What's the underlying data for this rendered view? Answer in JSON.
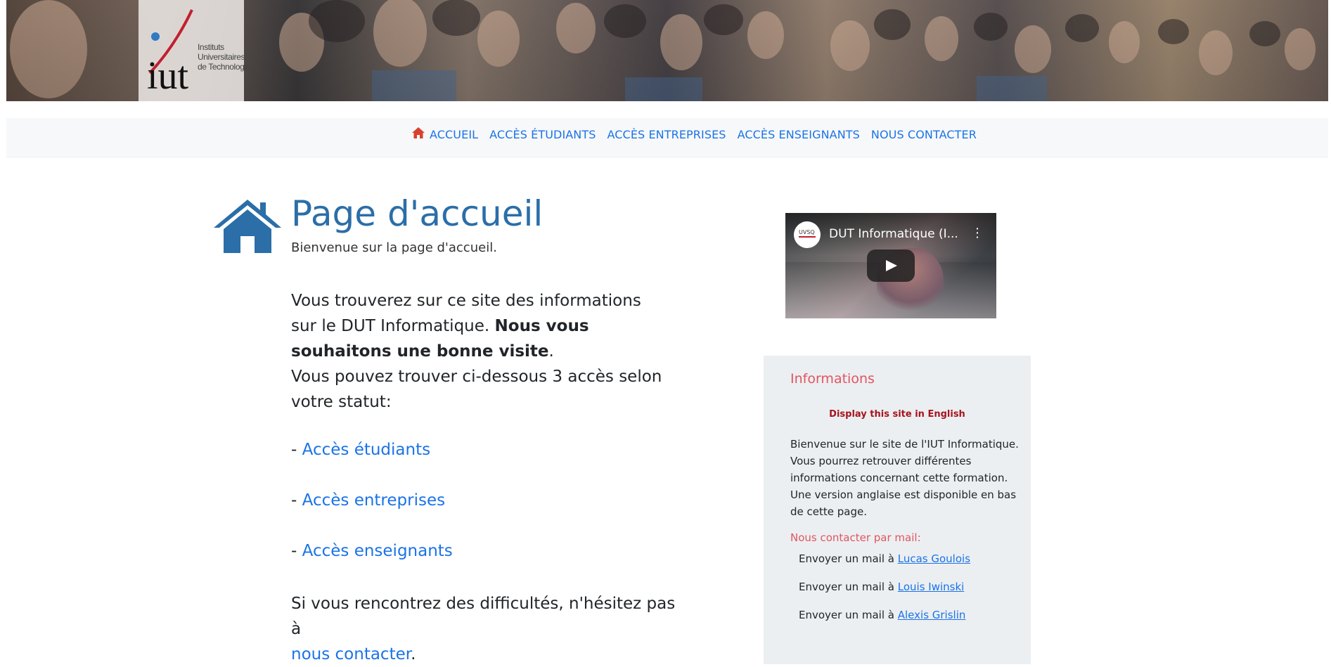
{
  "banner": {
    "logo_wordmark": "iut",
    "logo_lines": [
      "Instituts",
      "Universitaires",
      "de Technologie"
    ]
  },
  "nav": {
    "items": [
      {
        "label": "ACCUEIL",
        "icon": "home-icon"
      },
      {
        "label": "ACCÈS ÉTUDIANTS"
      },
      {
        "label": "ACCÈS ENTREPRISES"
      },
      {
        "label": "ACCÈS ENSEIGNANTS"
      },
      {
        "label": "NOUS CONTACTER"
      }
    ],
    "home_icon_color": "#d9412e",
    "link_color": "#1a73e8"
  },
  "main": {
    "title": "Page d'accueil",
    "subtitle": "Bienvenue sur la page d'accueil.",
    "intro_part1": "Vous trouverez sur ce site des informations sur le DUT Informatique.",
    "intro_bold": "Nous vous souhaitons une bonne visite",
    "intro_part2": ".",
    "intro_line2": "Vous pouvez trouver ci-dessous 3 accès selon votre statut:",
    "access_prefix": "- ",
    "access_links": [
      "Accès étudiants",
      "Accès entreprises",
      "Accès enseignants"
    ],
    "outro_text": "Si vous rencontrez des difficultés, n'hésitez pas à",
    "outro_link": "nous contacter",
    "outro_end": ".",
    "title_color": "#2b6ea8"
  },
  "video": {
    "title": "DUT Informatique (I...",
    "channel_label": "UVSQ"
  },
  "info": {
    "title": "Informations",
    "english_link": "Display this site in English",
    "text": "Bienvenue sur le site de l'IUT Informatique. Vous pourrez retrouver différentes informations concernant cette formation. Une version anglaise est disponible en bas de cette page.",
    "contact_title": "Nous contacter par mail:",
    "mail_prefix": "Envoyer un mail à",
    "contacts": [
      "Lucas Goulois",
      "Louis Iwinski",
      "Alexis Grislin"
    ],
    "accent_color": "#e05563"
  }
}
